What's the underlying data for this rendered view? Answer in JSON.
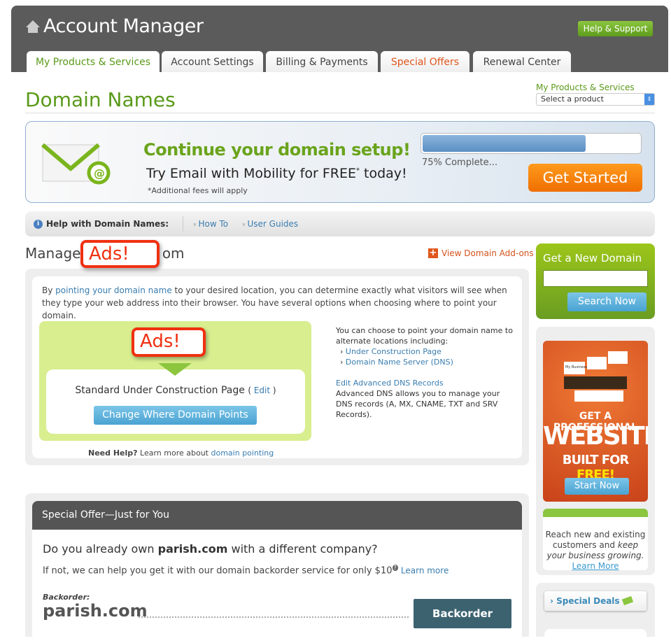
{
  "header": {
    "title": "Account Manager",
    "help_button": "Help & Support",
    "tabs": [
      {
        "label": "My Products & Services",
        "active": true
      },
      {
        "label": "Account Settings"
      },
      {
        "label": "Billing & Payments"
      },
      {
        "label": "Special Offers"
      },
      {
        "label": "Renewal Center"
      }
    ]
  },
  "page": {
    "title": "Domain Names",
    "product_select_label": "My Products & Services",
    "product_select_value": "Select a product"
  },
  "banner": {
    "headline": "Continue your domain setup!",
    "subline": "Try Email with Mobility for FREE",
    "subline_mark": "*",
    "subline_end": " today!",
    "footnote": "*Additional fees will apply",
    "progress_percent": 75,
    "progress_text": "75% Complete...",
    "cta": "Get Started"
  },
  "helpbar": {
    "label": "Help with Domain Names:",
    "links": [
      "How To",
      "User Guides"
    ]
  },
  "manage": {
    "heading_start": "Manage ",
    "heading_end": "om",
    "addons_link": "View Domain Add-ons",
    "intro_start": "By ",
    "intro_link": "pointing your domain name",
    "intro_end": " to your desired location, you can determine exactly what visitors will see when they type your web address into their browser. You have several options when choosing where to point your domain.",
    "current": "Standard Under Construction Page",
    "edit": "Edit",
    "change_button": "Change Where Domain Points",
    "need_help_bold": "Need Help?",
    "need_help_text": " Learn more about ",
    "need_help_link": "domain pointing",
    "right_intro": "You can choose to point your domain name to alternate locations including:",
    "options": [
      "Under Construction Page",
      "Domain Name Server (DNS)"
    ],
    "adv_link": "Edit Advanced DNS Records",
    "adv_text": "Advanced DNS allows you to manage your DNS records (A, MX, CNAME, TXT and SRV Records)."
  },
  "ads_overlay": "Ads!",
  "sidebar": {
    "new_domain_title": "Get a New Domain",
    "search_value": "",
    "search_button": "Search Now",
    "ad": {
      "line1": "GET A PROFESSIONAL",
      "line2": "WEBSITE",
      "line3a": "BUILT FOR ",
      "line3b": "FREE!",
      "button": "Start Now",
      "thumb_label": "My Business"
    },
    "reach_a": "Reach new and existing customers and ",
    "reach_em": "keep your business growing.",
    "reach_link": "Learn More",
    "special_deals": "Special Deals"
  },
  "offer": {
    "header": "Special Offer—Just for You",
    "q_start": "Do you already own ",
    "domain": "parish.com",
    "q_end": " with a different company?",
    "ifnot": "If not, we can help you get it with our domain backorder service for only $10",
    "ifnot_help": "?",
    "learn_more": "Learn more",
    "backorder_label": "Backorder:",
    "backorder_button": "Backorder"
  },
  "colors": {
    "green": "#5a9a1a",
    "orange": "#ef6f00",
    "header": "#5b5b5b",
    "link": "#3a7db0"
  }
}
